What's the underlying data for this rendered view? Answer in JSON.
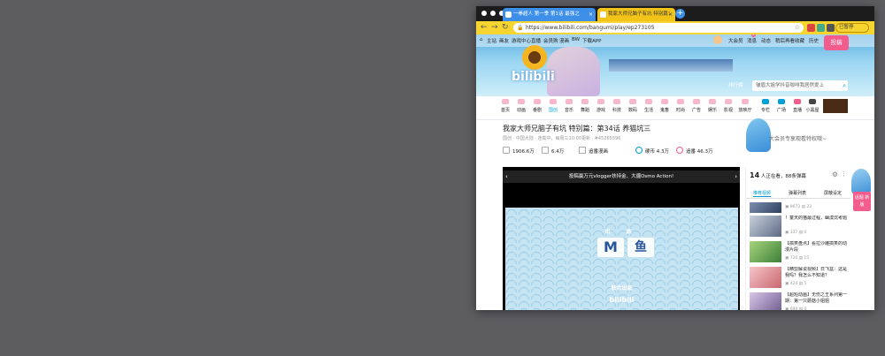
{
  "browser": {
    "tabs": [
      {
        "label": "一拳超人 第一季 第1话 最强之",
        "active": false
      },
      {
        "label": "我家大师兄脑子有坑 特别篇：",
        "active": true
      }
    ],
    "url": "https://www.bilibili.com/bangumi/play/ep273105",
    "user_label": "已暂停"
  },
  "site": {
    "topnav": [
      "主站",
      "画友",
      "游戏中心",
      "直播",
      "会员购",
      "漫画",
      "BW",
      "下载APP"
    ],
    "usernav": [
      "大会员",
      "消息",
      "动态",
      "稍后再看",
      "收藏",
      "历史"
    ],
    "message_count": "3",
    "upload_button": "投稿",
    "logo": "bilibili",
    "rank_label": "排行榜",
    "search_placeholder": "皱眉大姐学抖音咖啡我居然爱上",
    "categories": [
      "首页",
      "动画",
      "番剧",
      "国创",
      "音乐",
      "舞蹈",
      "游戏",
      "科技",
      "数码",
      "生活",
      "鬼畜",
      "时尚",
      "广告",
      "娱乐",
      "影视",
      "放映厅",
      "专栏",
      "广场",
      "直播",
      "小黑屋"
    ],
    "category_badges": [
      "",
      "999+",
      "191",
      "40",
      "999+",
      "373",
      "999+",
      "999+",
      "302",
      "999+",
      "188",
      "194",
      "",
      "999+",
      "309",
      "",
      "",
      "",
      "",
      ""
    ]
  },
  "video": {
    "title": "我家大师兄脑子有坑 特别篇：第34话 养猫坑三",
    "meta": "国创 · 中国大陆 · 连载中，每周三10:00更新 · #45265396",
    "stats": {
      "views": "1906.6万",
      "danmaku": "6.4万",
      "follow": "追番漫画",
      "coins": "硬币 4.3万",
      "likes": "追番 46.3万"
    },
    "vip_text": "大会员专享观看特权哦~"
  },
  "player": {
    "banner": "投稿赢万元vlogger扶持金、大疆Osmo Action!",
    "frame_top": "出 品",
    "frame_bottom": "联合出品",
    "logo_m": "M",
    "logo_fish": "鱼",
    "logo_bili": "bilibili"
  },
  "side": {
    "viewer_count": "14",
    "viewer_text": "人正在看，88条弹幕",
    "tabs": [
      "推荐视频",
      "弹幕列表",
      "屏蔽设定"
    ],
    "items": [
      {
        "title": "",
        "views": "9673",
        "danmaku": "23"
      },
      {
        "title": "！童天的猫最过程，幽漠式考题",
        "views": "337",
        "danmaku": "0"
      },
      {
        "title": "【搞笑盘点】看拉沙雕搞笑的动漫片段",
        "views": "720",
        "danmaku": "15"
      },
      {
        "title": "【精剪解说视频】日飞盆：这是我吗？我怎么不知道？",
        "views": "424",
        "danmaku": "5"
      },
      {
        "title": "【超短动画】无伤之王系列第一期：第一只蘑菇小姐姐",
        "views": "699",
        "danmaku": "0"
      }
    ]
  },
  "float": {
    "button": "话题 新版"
  }
}
